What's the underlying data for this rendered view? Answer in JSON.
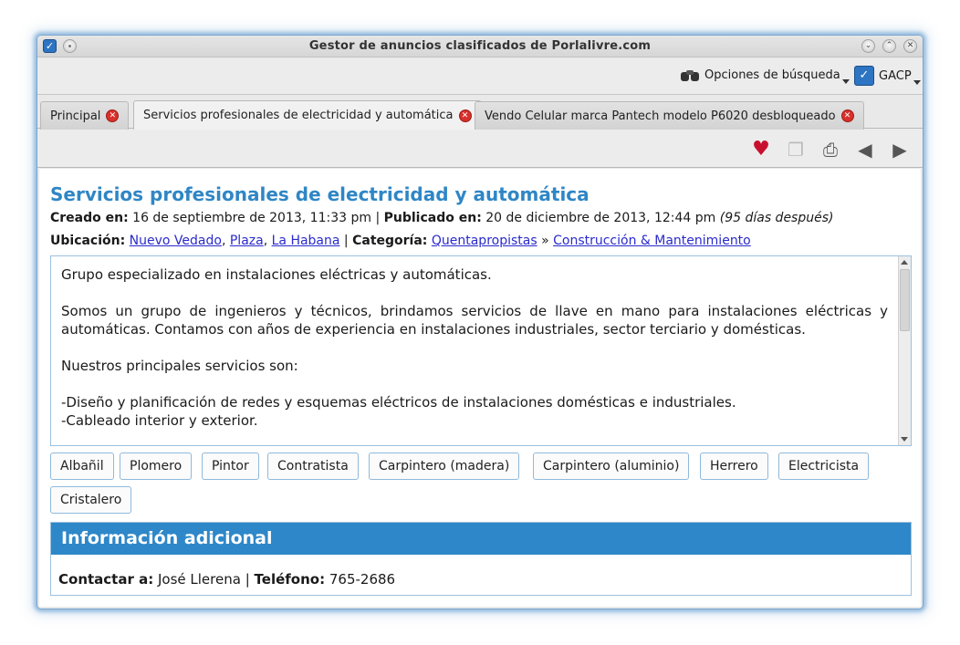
{
  "window": {
    "title": "Gestor de anuncios clasificados de Porlalivre.com"
  },
  "toolbar": {
    "search_label": "Opciones de búsqueda",
    "user_label": "GACP"
  },
  "tabs": [
    {
      "label": "Principal"
    },
    {
      "label": "Servicios profesionales de electricidad y automática"
    },
    {
      "label": "Vendo Celular marca Pantech modelo P6020 desbloqueado"
    }
  ],
  "ad": {
    "title": "Servicios profesionales de electricidad y automática",
    "created_label": "Creado en:",
    "created_value": "16 de septiembre de 2013, 11:33 pm",
    "published_label": "Publicado en:",
    "published_value": "20 de diciembre de 2013, 12:44 pm",
    "published_note": "(95 días después)",
    "location_label": "Ubicación:",
    "location": [
      "Nuevo Vedado",
      "Plaza",
      "La Habana"
    ],
    "category_label": "Categoría:",
    "category": [
      "Quentapropistas",
      "Construcción & Mantenimiento"
    ],
    "description": [
      "Grupo especializado en instalaciones eléctricas y automáticas.",
      "Somos un grupo de ingenieros y técnicos, brindamos servicios de llave en mano para instalaciones eléctricas y automáticas. Contamos con años de experiencia en instalaciones industriales, sector terciario y domésticas.",
      "Nuestros principales servicios son:",
      "-Diseño y planificación de redes y esquemas eléctricos de instalaciones domésticas e industriales.",
      "-Cableado interior y exterior."
    ]
  },
  "tags": [
    "Albañil",
    "Plomero",
    "Pintor",
    "Contratista",
    "Carpintero (madera)",
    "Carpintero (aluminio)",
    "Herrero",
    "Electricista",
    "Cristalero"
  ],
  "info": {
    "heading": "Información adicional",
    "contact_label": "Contactar a:",
    "contact_name": "José Llerena",
    "phone_label": "Teléfono:",
    "phone": "765-2686"
  }
}
